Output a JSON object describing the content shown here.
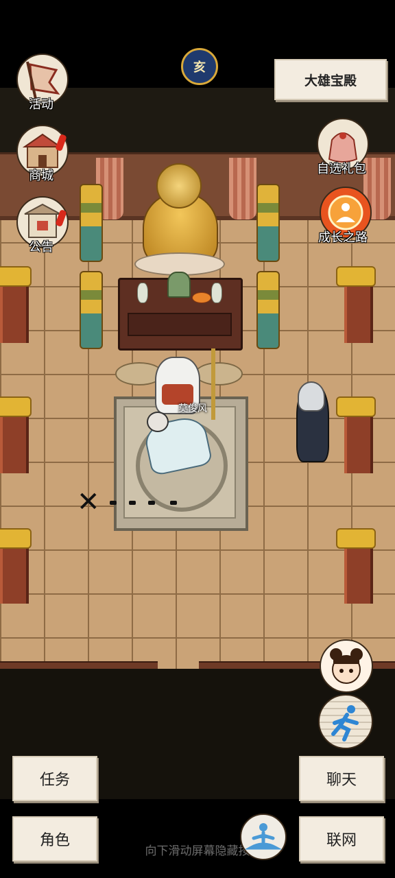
{
  "top": {
    "location_name": "大雄宝殿",
    "time_icon": "moon-clock-icon",
    "time_glyph": "亥"
  },
  "left_menu": [
    {
      "label": "活动",
      "icon": "flag-icon",
      "badge": false
    },
    {
      "label": "商城",
      "icon": "shop-icon",
      "badge": true
    },
    {
      "label": "公告",
      "icon": "notice-board-icon",
      "badge": true
    }
  ],
  "right_menu": [
    {
      "label": "自选礼包",
      "icon": "gift-bag-icon"
    },
    {
      "label": "成长之路",
      "icon": "growth-path-icon"
    }
  ],
  "scene": {
    "npc_name": "莫俊风",
    "colors": {
      "floor": "#caa377",
      "wall": "#7a4a33",
      "pillar": "#8e3f28",
      "gold": "#e2b434"
    }
  },
  "side_buttons": [
    {
      "icon": "companion-avatar-icon"
    },
    {
      "icon": "run-icon"
    }
  ],
  "bottom": {
    "task_label": "任务",
    "role_label": "角色",
    "chat_label": "聊天",
    "network_label": "联网",
    "meditate_icon": "meditate-icon",
    "hint": "向下滑动屏幕隐藏按"
  }
}
